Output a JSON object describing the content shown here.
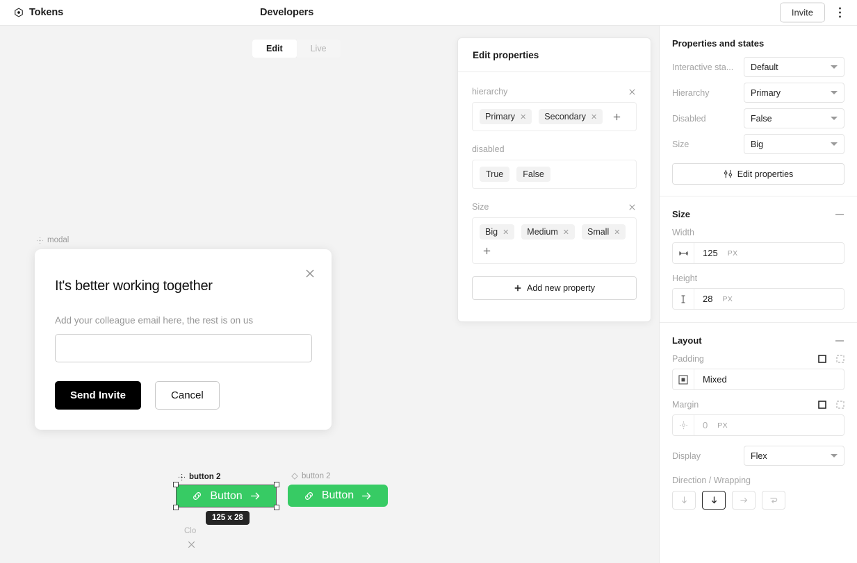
{
  "topbar": {
    "brand_label": "Tokens",
    "brand_icon": "target-icon",
    "page_title": "Developers",
    "invite_label": "Invite",
    "kebab_icon": "more-vertical-icon"
  },
  "canvas": {
    "mode_toggle": {
      "edit_label": "Edit",
      "live_label": "Live",
      "active": "Edit"
    },
    "modal": {
      "node_label": "modal",
      "close_icon": "close-icon",
      "title": "It's better working together",
      "subtitle": "Add your colleague email here, the rest is on us",
      "input_value": "",
      "input_placeholder": "",
      "primary_label": "Send Invite",
      "secondary_label": "Cancel"
    },
    "buttons": {
      "selected_node_label": "button 2",
      "plain_node_label": "button 2",
      "button_text": "Button",
      "link_icon": "link-icon",
      "arrow_icon": "arrow-right-icon",
      "size_badge": "125 x 28",
      "green_color": "#37cb64",
      "ghost_label": "Clo",
      "ghost_icon": "close-icon"
    }
  },
  "edit_panel": {
    "title": "Edit properties",
    "groups": [
      {
        "name": "hierarchy",
        "removable": true,
        "chips": [
          {
            "label": "Primary",
            "removable": true
          },
          {
            "label": "Secondary",
            "removable": true
          }
        ],
        "add_label": "+"
      },
      {
        "name": "disabled",
        "removable": false,
        "chips": [
          {
            "label": "True",
            "removable": false
          },
          {
            "label": "False",
            "removable": false
          }
        ],
        "add_label": ""
      },
      {
        "name": "Size",
        "removable": true,
        "chips": [
          {
            "label": "Big",
            "removable": true
          },
          {
            "label": "Medium",
            "removable": true
          },
          {
            "label": "Small",
            "removable": true
          }
        ],
        "add_label": "+"
      }
    ],
    "add_new_property_label": "Add new property"
  },
  "sidebar": {
    "properties": {
      "title": "Properties and states",
      "rows": [
        {
          "label": "Interactive sta...",
          "value": "Default"
        },
        {
          "label": "Hierarchy",
          "value": "Primary"
        },
        {
          "label": "Disabled",
          "value": "False"
        },
        {
          "label": "Size",
          "value": "Big"
        }
      ],
      "edit_properties_label": "Edit properties",
      "edit_properties_icon": "sliders-icon"
    },
    "size": {
      "title": "Size",
      "collapse_icon": "minus-icon",
      "width_label": "Width",
      "width_value": "125",
      "width_unit": "PX",
      "width_icon": "width-icon",
      "height_label": "Height",
      "height_value": "28",
      "height_unit": "PX",
      "height_icon": "height-icon"
    },
    "layout": {
      "title": "Layout",
      "collapse_icon": "minus-icon",
      "padding_label": "Padding",
      "padding_value": "Mixed",
      "padding_icon": "padding-icon",
      "padding_mode_all_icon": "square-icon",
      "padding_mode_sides_icon": "dashed-square-icon",
      "margin_label": "Margin",
      "margin_value": "0",
      "margin_unit": "PX",
      "margin_icon": "margin-icon",
      "margin_mode_all_icon": "square-icon",
      "margin_mode_sides_icon": "dashed-square-icon",
      "display_label": "Display",
      "display_value": "Flex",
      "direction_label": "Direction / Wrapping",
      "direction_buttons": [
        {
          "icon": "arrow-down-icon",
          "active": false
        },
        {
          "icon": "arrow-down-icon",
          "active": true
        },
        {
          "icon": "arrow-right-icon",
          "active": false
        },
        {
          "icon": "arrow-wrap-icon",
          "active": false
        }
      ]
    }
  }
}
